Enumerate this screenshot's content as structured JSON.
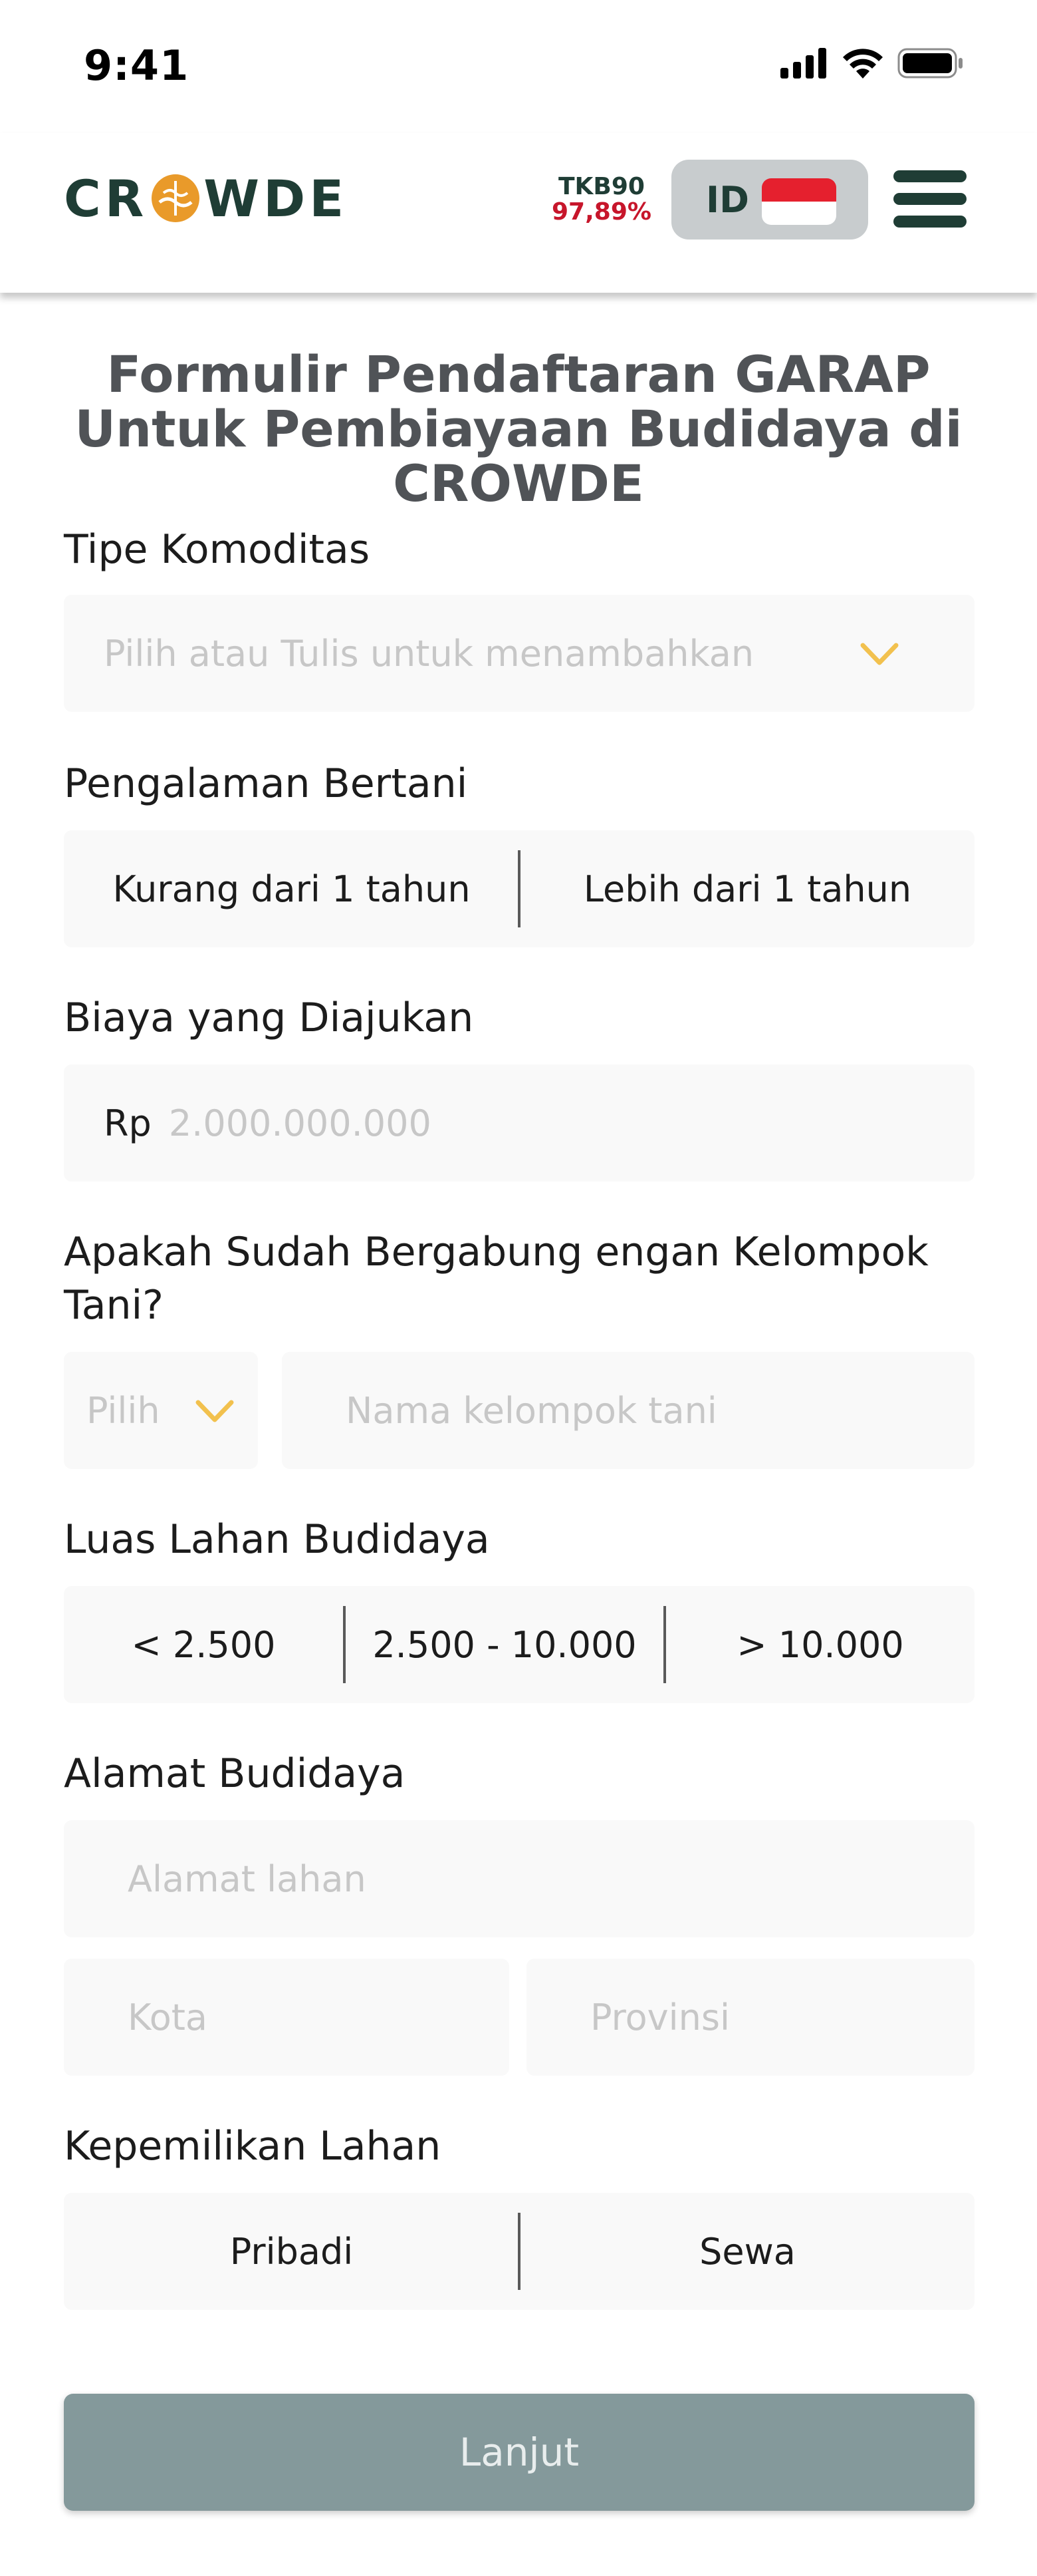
{
  "status_bar": {
    "time": "9:41"
  },
  "header": {
    "logo_left": "CR",
    "logo_right": "WDE",
    "tkb_label": "TKB90",
    "tkb_value": "97,89%",
    "language_code": "ID"
  },
  "form": {
    "title": "Formulir Pendaftaran GARAP Untuk Pembiayaan Budidaya di CROWDE",
    "commodity": {
      "label": "Tipe Komoditas",
      "placeholder": "Pilih atau Tulis untuk menambahkan"
    },
    "experience": {
      "label": "Pengalaman Bertani",
      "options": [
        "Kurang dari 1 tahun",
        "Lebih dari 1 tahun"
      ]
    },
    "cost": {
      "label": "Biaya yang Diajukan",
      "currency": "Rp",
      "placeholder": "2.000.000.000"
    },
    "farmer_group": {
      "label": "Apakah Sudah Bergabung engan Kelompok Tani?",
      "select_placeholder": "Pilih",
      "name_placeholder": "Nama kelompok tani"
    },
    "land_area": {
      "label": "Luas Lahan Budidaya",
      "options": [
        "< 2.500",
        "2.500 - 10.000",
        "> 10.000"
      ]
    },
    "address": {
      "label": "Alamat Budidaya",
      "land_placeholder": "Alamat lahan",
      "city_placeholder": "Kota",
      "province_placeholder": "Provinsi"
    },
    "ownership": {
      "label": "Kepemilikan Lahan",
      "options": [
        "Pribadi",
        "Sewa"
      ]
    },
    "submit_label": "Lanjut"
  },
  "colors": {
    "brand_dark": "#1f3d35",
    "brand_orange": "#e99a2a",
    "tkb_red": "#c7162b",
    "chevron_yellow": "#f2c14e",
    "submit_disabled": "#84999b"
  },
  "icons": [
    "signal-icon",
    "wifi-icon",
    "battery-icon",
    "logo-emblem-icon",
    "indonesia-flag-icon",
    "hamburger-menu-icon",
    "chevron-down-icon"
  ]
}
